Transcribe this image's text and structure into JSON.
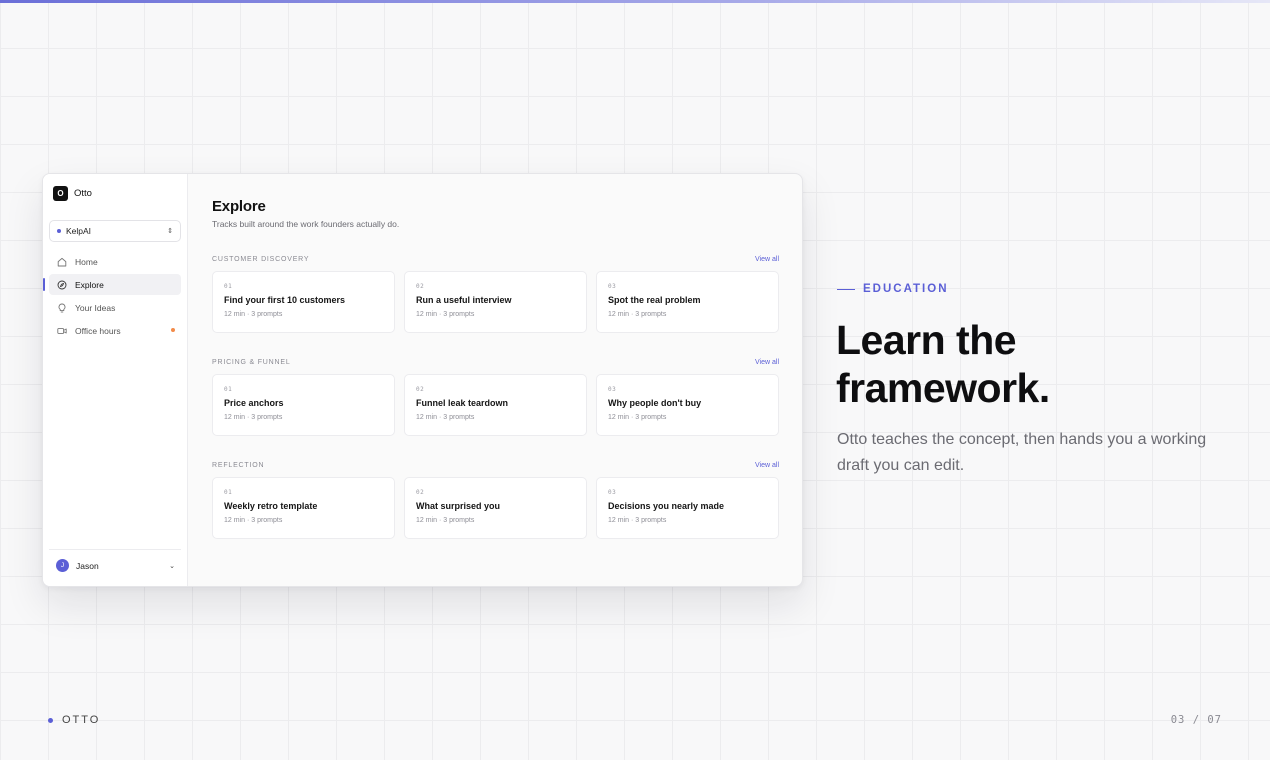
{
  "app": {
    "brand": {
      "logo_letter": "O",
      "name": "Otto"
    },
    "workspace": {
      "name": "KelpAI"
    },
    "nav": [
      {
        "label": "Home",
        "icon": "home-icon",
        "active": false
      },
      {
        "label": "Explore",
        "icon": "compass-icon",
        "active": true
      },
      {
        "label": "Your Ideas",
        "icon": "lightbulb-icon",
        "active": false
      },
      {
        "label": "Office hours",
        "icon": "video-icon",
        "active": false,
        "dot": true
      }
    ],
    "user": {
      "initial": "J",
      "name": "Jason"
    },
    "main": {
      "title": "Explore",
      "subtitle": "Tracks built around the work founders actually do.",
      "sections": [
        {
          "label": "CUSTOMER DISCOVERY",
          "view_all": "View all",
          "cards": [
            {
              "num": "01",
              "title": "Find your first 10 customers",
              "meta": "12 min · 3 prompts"
            },
            {
              "num": "02",
              "title": "Run a useful interview",
              "meta": "12 min · 3 prompts"
            },
            {
              "num": "03",
              "title": "Spot the real problem",
              "meta": "12 min · 3 prompts"
            }
          ]
        },
        {
          "label": "PRICING & FUNNEL",
          "view_all": "View all",
          "cards": [
            {
              "num": "01",
              "title": "Price anchors",
              "meta": "12 min · 3 prompts"
            },
            {
              "num": "02",
              "title": "Funnel leak teardown",
              "meta": "12 min · 3 prompts"
            },
            {
              "num": "03",
              "title": "Why people don't buy",
              "meta": "12 min · 3 prompts"
            }
          ]
        },
        {
          "label": "REFLECTION",
          "view_all": "View all",
          "cards": [
            {
              "num": "01",
              "title": "Weekly retro template",
              "meta": "12 min · 3 prompts"
            },
            {
              "num": "02",
              "title": "What surprised you",
              "meta": "12 min · 3 prompts"
            },
            {
              "num": "03",
              "title": "Decisions you nearly made",
              "meta": "12 min · 3 prompts"
            }
          ]
        }
      ]
    }
  },
  "slide": {
    "eyebrow": "EDUCATION",
    "headline_line1": "Learn the",
    "headline_line2": "framework.",
    "body": "Otto teaches the concept, then hands you a working draft you can edit."
  },
  "footer": {
    "brand": "OTTO",
    "page": "03 / 07"
  },
  "colors": {
    "accent": "#5b5fd6",
    "notification": "#f28b4a",
    "text": "#111111",
    "muted": "#6b6b72"
  }
}
